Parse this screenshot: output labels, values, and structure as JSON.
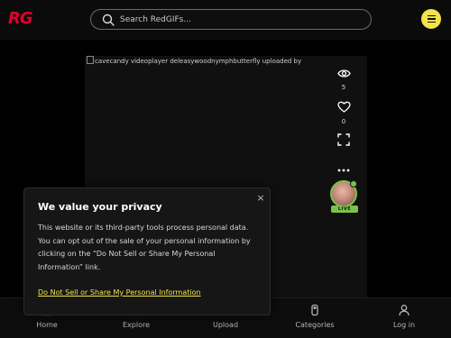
{
  "header": {
    "logo": "RG",
    "search_placeholder": "Search RedGIFs...",
    "menu_icon": "hamburger-menu-icon",
    "accent": "#f2e34a",
    "brand": "#e0002e"
  },
  "video": {
    "caption": "cavecandy videoplayer deleasywoodnymphbutterfly uploaded by",
    "actions": {
      "views_count": "5",
      "likes_count": "0"
    },
    "live_badge": "LIVE",
    "live_color": "#7cc24a"
  },
  "bottom_nav": {
    "items": [
      {
        "label": "Home",
        "icon": "home-icon"
      },
      {
        "label": "Explore",
        "icon": "compass-icon"
      },
      {
        "label": "Upload",
        "icon": "upload-icon"
      },
      {
        "label": "Categories",
        "icon": "tag-icon"
      },
      {
        "label": "Log in",
        "icon": "user-icon"
      }
    ]
  },
  "privacy_dialog": {
    "title": "We value your privacy",
    "body": "This website or its third-party tools process personal data. You can opt out of the sale of your personal information by clicking on the “Do Not Sell or Share My Personal Information” link.",
    "link": "Do Not Sell or Share My Personal Information",
    "close_symbol": "×"
  }
}
